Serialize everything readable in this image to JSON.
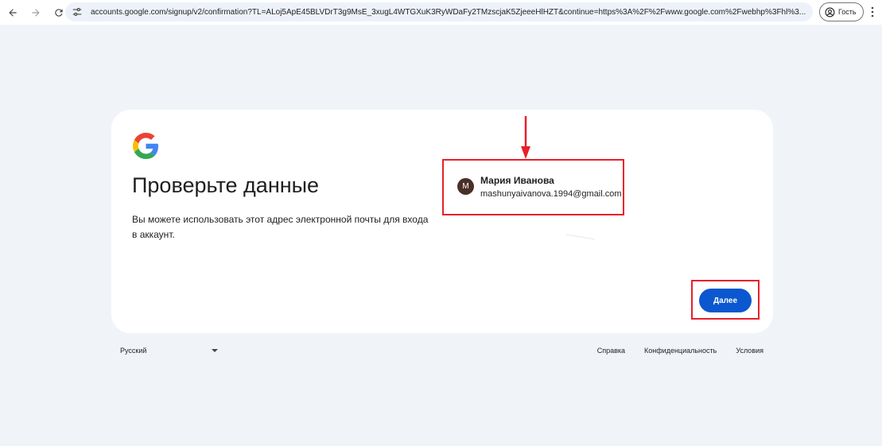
{
  "browser": {
    "url": "accounts.google.com/signup/v2/confirmation?TL=ALoj5ApE45BLVDrT3g9MsE_3xugL4WTGXuK3RyWDaFy2TMzscjaK5ZjeeeHlHZT&continue=https%3A%2F%2Fwww.google.com%2Fwebhp%3Fhl%3...",
    "guest_label": "Гость"
  },
  "card": {
    "title": "Проверьте данные",
    "description": "Вы можете использовать этот адрес электронной почты для входа в аккаунт.",
    "account": {
      "initial": "М",
      "name": "Мария Иванова",
      "email": "mashunyaivanova.1994@gmail.com"
    },
    "next_label": "Далее"
  },
  "footer": {
    "language": "Русский",
    "links": [
      "Справка",
      "Конфиденциальность",
      "Условия"
    ]
  },
  "colors": {
    "primary": "#0b57d0",
    "annotation": "#e8202a",
    "background": "#f0f4f9",
    "avatar": "#4a2f27"
  }
}
